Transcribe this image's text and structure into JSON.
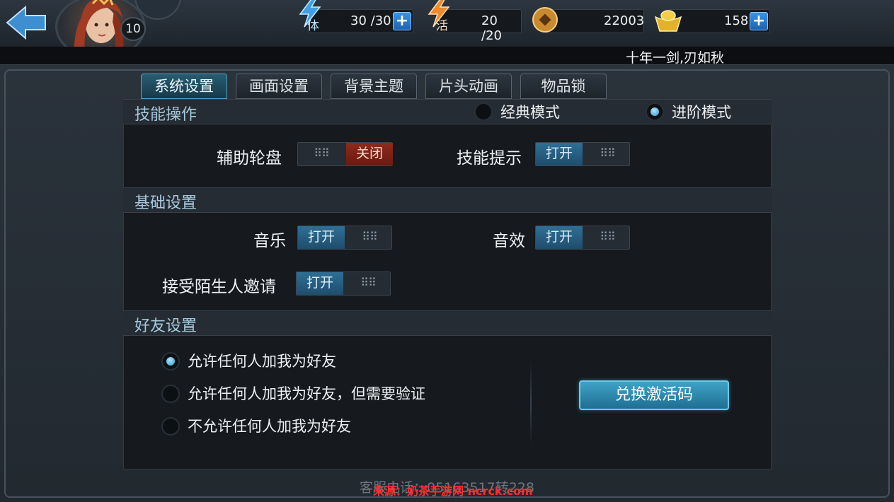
{
  "header": {
    "level": "10",
    "stamina": "30 /30",
    "activity": "20 /20",
    "coins": "22003",
    "gold": "158",
    "stamina_icon_char": "体",
    "activity_icon_char": "活",
    "marquee": "十年一剑,刃如秋"
  },
  "tabs": [
    {
      "label": "系统设置",
      "active": true
    },
    {
      "label": "画面设置",
      "active": false
    },
    {
      "label": "背景主题",
      "active": false
    },
    {
      "label": "片头动画",
      "active": false
    },
    {
      "label": "物品锁",
      "active": false
    }
  ],
  "skill_section": {
    "title": "技能操作",
    "mode_classic": "经典模式",
    "mode_advanced": "进阶模式",
    "selected_mode": "进阶模式",
    "assist_wheel_label": "辅助轮盘",
    "assist_wheel_state": "关闭",
    "skill_hint_label": "技能提示",
    "skill_hint_state": "打开"
  },
  "basic_section": {
    "title": "基础设置",
    "music_label": "音乐",
    "music_state": "打开",
    "sfx_label": "音效",
    "sfx_state": "打开",
    "stranger_invite_label": "接受陌生人邀请",
    "stranger_invite_state": "打开"
  },
  "friend_section": {
    "title": "好友设置",
    "options": [
      "允许任何人加我为好友",
      "允许任何人加我为好友，但需要验证",
      "不允许任何人加我为好友"
    ],
    "selected_index": 0,
    "redeem_button": "兑换激活码"
  },
  "footer": {
    "service_text": "客服电话：05163517转228",
    "watermark": "来源：奶茶手游网 ncrck.com"
  },
  "colors": {
    "accent_blue": "#2f6f96",
    "toggle_off_red": "#8e2a1c",
    "section_title": "#a6c9dd"
  },
  "icons": {
    "back": "back-arrow-icon",
    "stamina": "lightning-icon",
    "activity": "lightning-icon",
    "coin": "copper-coin-icon",
    "gold": "gold-ingot-icon",
    "plus": "plus-icon",
    "grip": "grip-dots-icon"
  }
}
